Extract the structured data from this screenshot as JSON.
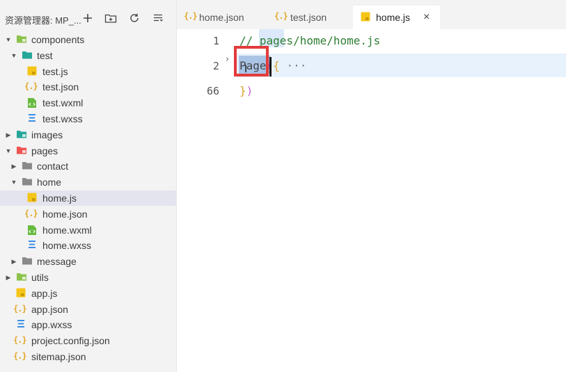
{
  "explorer": {
    "title": "资源管理器: MP_...",
    "actions": [
      "new-file",
      "new-folder",
      "refresh",
      "collapse-all"
    ],
    "tree": [
      {
        "label": "components",
        "depth": 0,
        "type": "folder-special",
        "color": "#8bc34a",
        "expanded": true
      },
      {
        "label": "test",
        "depth": 1,
        "type": "folder-open",
        "color": "#26a69a",
        "expanded": true
      },
      {
        "label": "test.js",
        "depth": 2,
        "type": "js"
      },
      {
        "label": "test.json",
        "depth": 2,
        "type": "json"
      },
      {
        "label": "test.wxml",
        "depth": 2,
        "type": "wxml"
      },
      {
        "label": "test.wxss",
        "depth": 2,
        "type": "wxss"
      },
      {
        "label": "images",
        "depth": 0,
        "type": "folder-special",
        "color": "#26a69a",
        "expanded": false
      },
      {
        "label": "pages",
        "depth": 0,
        "type": "folder-special",
        "color": "#ef5350",
        "expanded": true
      },
      {
        "label": "contact",
        "depth": 1,
        "type": "folder",
        "color": "#8a8a8a",
        "expanded": false
      },
      {
        "label": "home",
        "depth": 1,
        "type": "folder-open",
        "color": "#8a8a8a",
        "expanded": true
      },
      {
        "label": "home.js",
        "depth": 2,
        "type": "js",
        "selected": true
      },
      {
        "label": "home.json",
        "depth": 2,
        "type": "json"
      },
      {
        "label": "home.wxml",
        "depth": 2,
        "type": "wxml"
      },
      {
        "label": "home.wxss",
        "depth": 2,
        "type": "wxss"
      },
      {
        "label": "message",
        "depth": 1,
        "type": "folder",
        "color": "#8a8a8a",
        "expanded": false
      },
      {
        "label": "utils",
        "depth": 0,
        "type": "folder-special",
        "color": "#8bc34a",
        "expanded": false
      },
      {
        "label": "app.js",
        "depth": 0,
        "type": "js"
      },
      {
        "label": "app.json",
        "depth": 0,
        "type": "json"
      },
      {
        "label": "app.wxss",
        "depth": 0,
        "type": "wxss"
      },
      {
        "label": "project.config.json",
        "depth": 0,
        "type": "json"
      },
      {
        "label": "sitemap.json",
        "depth": 0,
        "type": "json"
      }
    ]
  },
  "tabs": [
    {
      "label": "home.json",
      "icon": "json-icon",
      "active": false
    },
    {
      "label": "test.json",
      "icon": "json-icon",
      "active": false
    },
    {
      "label": "home.js",
      "icon": "js-icon",
      "active": true,
      "close": "×"
    }
  ],
  "editor": {
    "lines": [
      {
        "number": "1",
        "comment": "// pages/home/home.js"
      },
      {
        "number": "2",
        "keyword": "Page",
        "paren": "(",
        "brace": "{",
        "folded": " ···"
      },
      {
        "number": "66",
        "closing_brace": "}",
        "closing_paren": ")"
      }
    ],
    "fold_glyph": "›",
    "cursor_glyph": "I"
  },
  "colors": {
    "comment": "#2e7d32",
    "paren_outer": "#c266d6",
    "brace": "#d9a52b",
    "highlight_box": "#e33b3b",
    "selection": "#aac4e6",
    "js_icon": "#f5c518",
    "json_icon": "#e3a82b",
    "wxml_icon": "#66bb3f",
    "wxss_icon": "#3a8ee6"
  }
}
